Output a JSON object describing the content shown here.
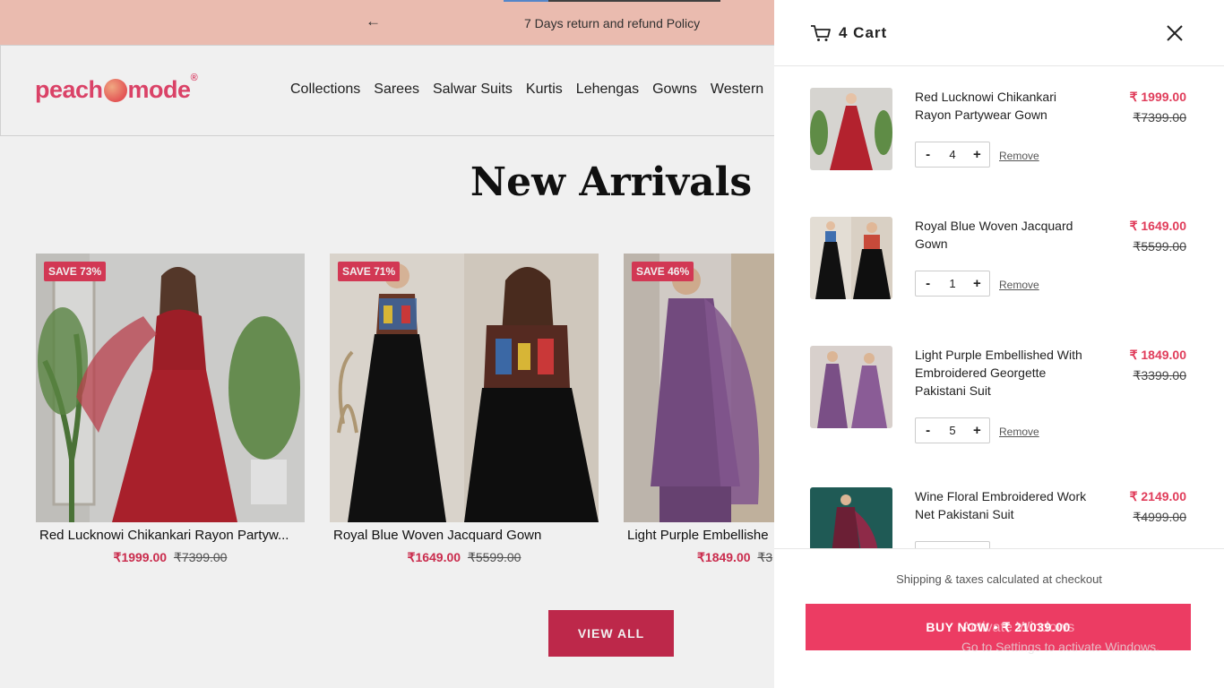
{
  "announcement": {
    "prev_icon": "arrow-left-icon",
    "message": "7 Days return and refund Policy"
  },
  "brand": {
    "logo_left": "peach",
    "logo_right": "mode",
    "registered": "®"
  },
  "nav": [
    "Collections",
    "Sarees",
    "Salwar Suits",
    "Kurtis",
    "Lehengas",
    "Gowns",
    "Western"
  ],
  "section": {
    "title": "New Arrivals",
    "view_all": "VIEW ALL"
  },
  "products": [
    {
      "badge": "SAVE 73%",
      "name": "Red Lucknowi Chikankari Rayon Partyw...",
      "price": "₹1999.00",
      "compare": "₹7399.00"
    },
    {
      "badge": "SAVE 71%",
      "name": "Royal Blue Woven Jacquard Gown",
      "price": "₹1649.00",
      "compare": "₹5599.00"
    },
    {
      "badge": "SAVE 46%",
      "name": "Light Purple Embellishe",
      "price": "₹1849.00",
      "compare": "₹3"
    }
  ],
  "cart": {
    "title": "4 Cart",
    "icon": "cart-icon",
    "close_icon": "close-icon",
    "items": [
      {
        "title": "Red Lucknowi Chikankari Rayon Partywear Gown",
        "price": "₹ 1999.00",
        "compare": "₹7399.00",
        "qty": "4",
        "remove": "Remove"
      },
      {
        "title": "Royal Blue Woven Jacquard Gown",
        "price": "₹ 1649.00",
        "compare": "₹5599.00",
        "qty": "1",
        "remove": "Remove"
      },
      {
        "title": "Light Purple Embellished With Embroidered Georgette Pakistani Suit",
        "price": "₹ 1849.00",
        "compare": "₹3399.00",
        "qty": "5",
        "remove": "Remove"
      },
      {
        "title": "Wine Floral Embroidered Work Net Pakistani Suit",
        "price": "₹ 2149.00",
        "compare": "₹4999.00",
        "qty": "",
        "remove": ""
      }
    ],
    "minus": "-",
    "plus": "+",
    "shipping_note": "Shipping & taxes calculated at checkout",
    "buy_now": "BUY NOW • ₹ 21039.00"
  },
  "watermark": {
    "line1": "Activate Windows",
    "line2": "Go to Settings to activate Windows."
  },
  "colors": {
    "announcement_bg": "#f9c7ba",
    "brand": "#e8476e",
    "sale_price": "#e03c5a",
    "buy_button": "#ec3c63",
    "view_all": "#c92b4f"
  }
}
